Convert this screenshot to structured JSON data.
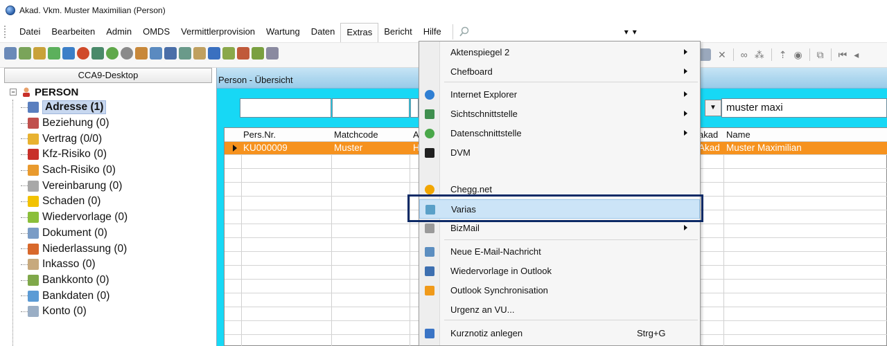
{
  "window": {
    "title": "Akad. Vkm. Muster Maximilian (Person)"
  },
  "menubar": {
    "items": [
      "Datei",
      "Bearbeiten",
      "Admin",
      "OMDS",
      "Vermittlerprovision",
      "Wartung",
      "Daten",
      "Extras",
      "Bericht",
      "Hilfe"
    ],
    "active": "Extras"
  },
  "left_panel": {
    "header": "CCA9-Desktop",
    "root": "PERSON",
    "items": [
      {
        "label": "Adresse (1)",
        "icon": "address-card-icon",
        "color": "#5a7fbf",
        "selected": true
      },
      {
        "label": "Beziehung (0)",
        "icon": "people-icon",
        "color": "#c0504d"
      },
      {
        "label": "Vertrag (0/0)",
        "icon": "contract-icon",
        "color": "#e8b230"
      },
      {
        "label": "Kfz-Risiko (0)",
        "icon": "car-icon",
        "color": "#c8302a"
      },
      {
        "label": "Sach-Risiko (0)",
        "icon": "house-icon",
        "color": "#e99a2e"
      },
      {
        "label": "Vereinbarung (0)",
        "icon": "agreement-icon",
        "color": "#a8a8a8"
      },
      {
        "label": "Schaden (0)",
        "icon": "warning-icon",
        "color": "#f2c200"
      },
      {
        "label": "Wiedervorlage (0)",
        "icon": "reminder-icon",
        "color": "#8bbf3a"
      },
      {
        "label": "Dokument (0)",
        "icon": "document-icon",
        "color": "#7a9cc6"
      },
      {
        "label": "Niederlassung (0)",
        "icon": "branch-icon",
        "color": "#d8682b"
      },
      {
        "label": "Inkasso (0)",
        "icon": "collection-icon",
        "color": "#c7a97d"
      },
      {
        "label": "Bankkonto (0)",
        "icon": "bank-icon",
        "color": "#7fa84a"
      },
      {
        "label": "Bankdaten (0)",
        "icon": "bankdata-icon",
        "color": "#5b9bd5"
      },
      {
        "label": "Konto (0)",
        "icon": "account-icon",
        "color": "#9aaec5"
      }
    ]
  },
  "main": {
    "header": "Person - Übersicht",
    "filter_value": "muster maxi",
    "grid": {
      "columns": [
        "Pers.Nr.",
        "Matchcode",
        "A",
        "akad",
        "Name"
      ],
      "rows": [
        {
          "pers_nr": "KU000009",
          "matchcode": "Muster",
          "a": "H",
          "akad": "Akad",
          "name": "Muster Maximilian"
        }
      ]
    }
  },
  "extras_menu": {
    "items": [
      {
        "label": "Aktenspiegel 2",
        "submenu": true
      },
      {
        "label": "Chefboard",
        "submenu": true
      },
      {
        "label": "Internet Explorer",
        "submenu": true,
        "icon": "internet-explorer-icon",
        "color": "#2f7fd3"
      },
      {
        "label": "Sichtschnittstelle",
        "submenu": true,
        "icon": "view-interface-icon",
        "color": "#3f8f4f"
      },
      {
        "label": "Datenschnittstelle",
        "submenu": true,
        "icon": "data-interface-icon",
        "color": "#4aa84a"
      },
      {
        "label": "DVM",
        "icon": "dvm-icon",
        "color": "#202020"
      },
      {
        "label": "Chegg.net",
        "icon": "chegg-icon",
        "color": "#f2a600"
      },
      {
        "label": "Varias",
        "icon": "varias-icon",
        "color": "#5aa0c8",
        "highlighted": true
      },
      {
        "label": "BizMail",
        "submenu": true,
        "icon": "bizmail-icon",
        "color": "#9a9a9a"
      },
      {
        "label": "Neue E-Mail-Nachricht",
        "icon": "new-email-icon",
        "color": "#5c8ec0"
      },
      {
        "label": "Wiedervorlage in Outlook",
        "icon": "calendar-icon",
        "color": "#3d6fb0"
      },
      {
        "label": "Outlook Synchronisation",
        "icon": "outlook-sync-icon",
        "color": "#f09a1a"
      },
      {
        "label": "Urgenz an VU..."
      },
      {
        "label": "Kurznotiz anlegen",
        "icon": "note-icon",
        "color": "#3a74c5",
        "shortcut": "Strg+G"
      }
    ]
  }
}
